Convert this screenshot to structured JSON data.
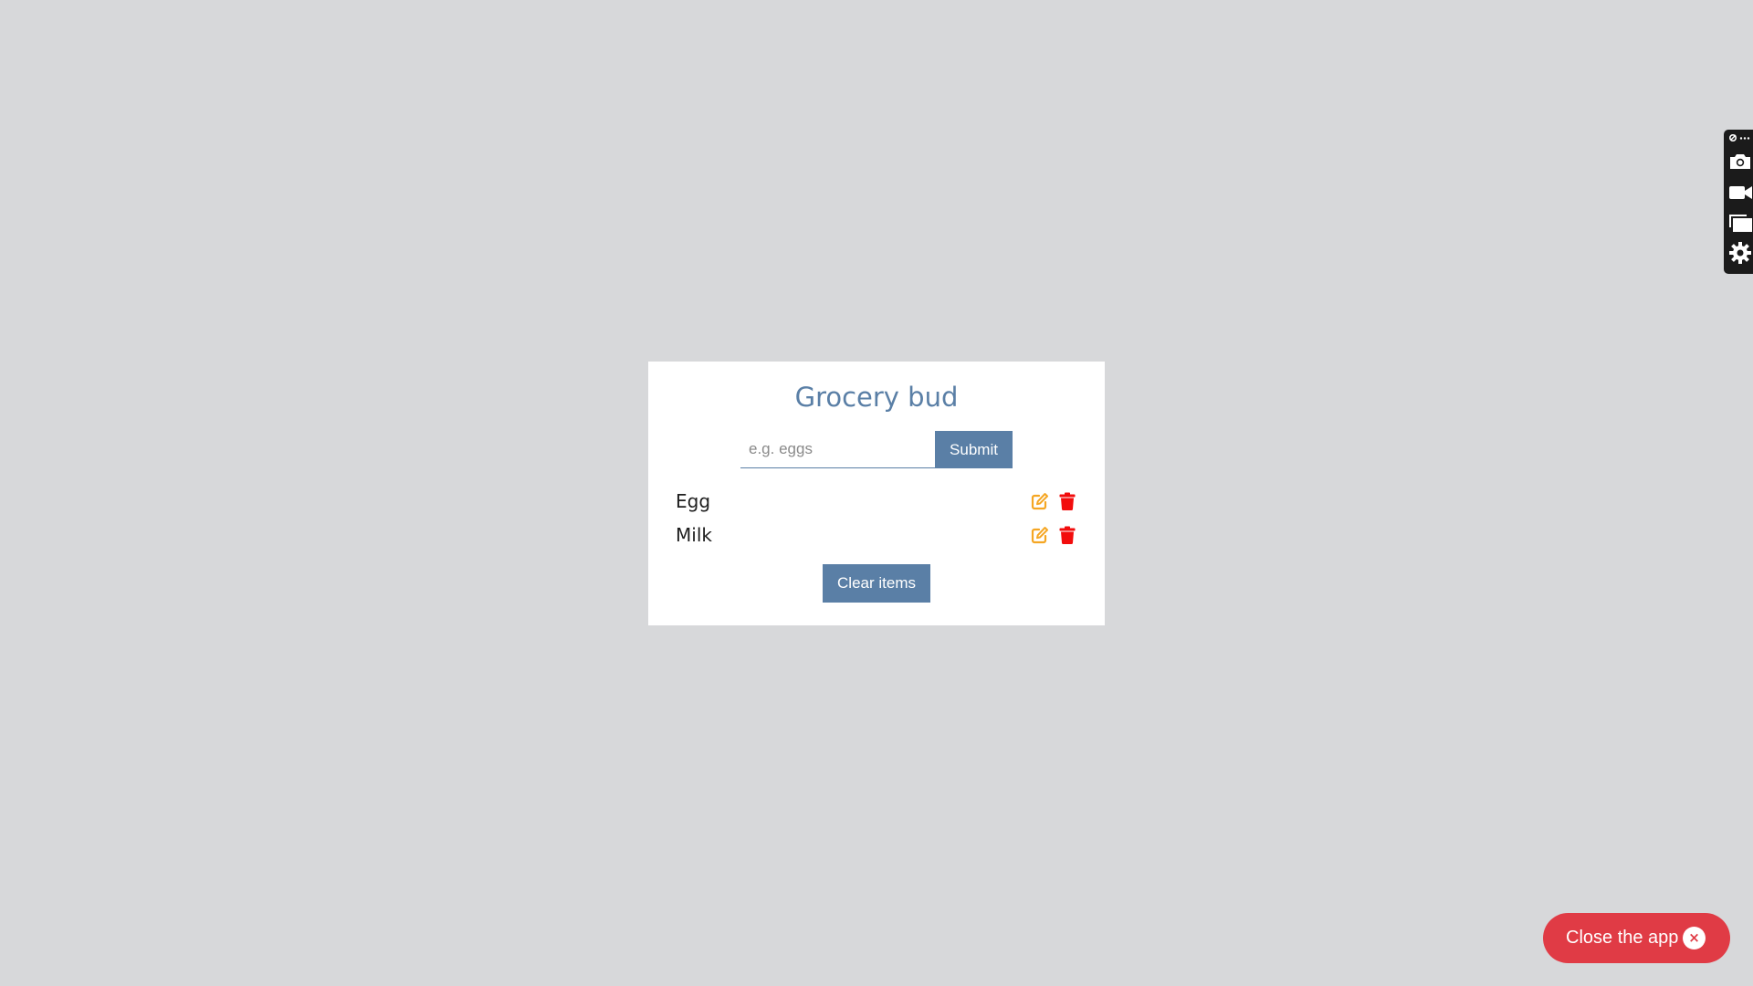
{
  "app": {
    "title": "Grocery bud"
  },
  "form": {
    "input_value": "",
    "input_placeholder": "e.g. eggs",
    "submit_label": "Submit"
  },
  "items": [
    {
      "name": "Egg",
      "edit_icon": "edit-icon",
      "delete_icon": "trash-icon"
    },
    {
      "name": "Milk",
      "edit_icon": "edit-icon",
      "delete_icon": "trash-icon"
    }
  ],
  "clear_label": "Clear items",
  "overlay": {
    "close_app_label": "Close the app",
    "close_icon": "close-icon"
  },
  "side_toolbar": {
    "icons": [
      "settings-link-icon",
      "more-icon",
      "camera-icon",
      "video-icon",
      "window-icon",
      "gear-icon"
    ]
  },
  "colors": {
    "page_bg": "#d7d8da",
    "accent": "#5a7fa6",
    "edit": "#f5a623",
    "delete": "#f20d0d",
    "close_button": "#e03b45"
  }
}
